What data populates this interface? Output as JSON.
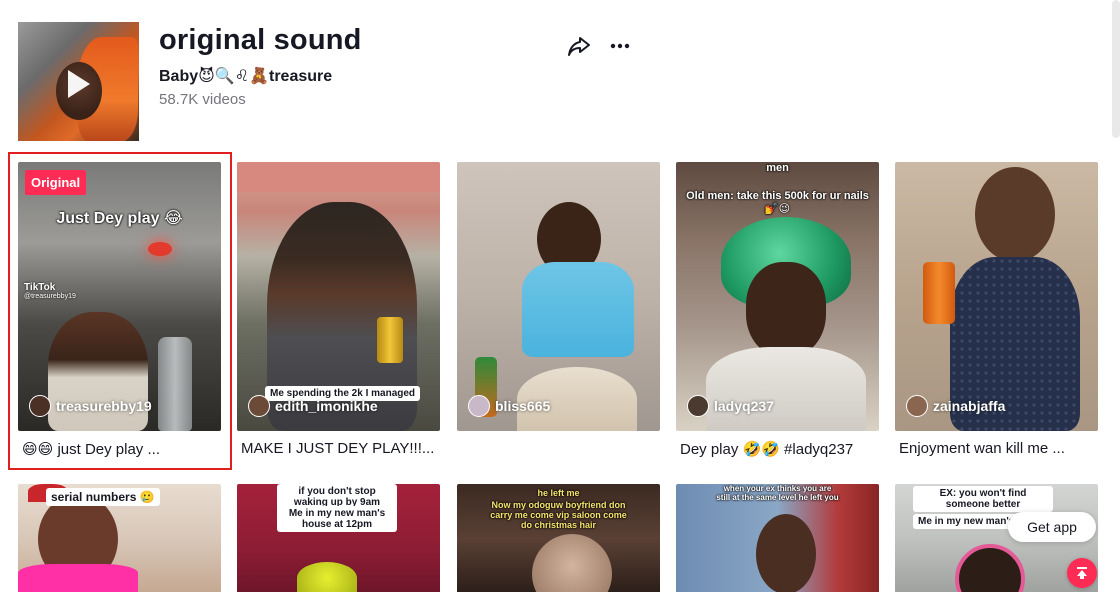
{
  "sound": {
    "title": "original sound",
    "author": "Baby😈🔍♌🧸treasure",
    "video_count": "58.7K videos"
  },
  "icons": {
    "share": "share-arrow-icon",
    "more": "more-dots-icon",
    "back_to_top": "arrow-up-icon"
  },
  "colors": {
    "accent": "#fe2c55",
    "selected_outline": "#e0201f"
  },
  "videos": [
    {
      "badge": "Original",
      "overlay": "Just Dey play 😂",
      "watermark": "TikTok",
      "watermark_handle": "@treasurebby19",
      "username": "treasurebby19",
      "caption": "😄😄 just Dey play ..."
    },
    {
      "overlay": "Me spending the 2k I managed",
      "username": "edith_imonikhe",
      "caption": "MAKE I JUST DEY PLAY!!!..."
    },
    {
      "overlay": "",
      "username": "bliss665",
      "caption": ""
    },
    {
      "overlay": "Old men: take this 500k for ur nails 💅😉",
      "overlay_top": "men",
      "username": "ladyq237",
      "caption": "Dey play 🤣🤣 #ladyq237"
    },
    {
      "overlay": "",
      "username": "zainabjaffa",
      "caption": "Enjoyment wan kill me ..."
    },
    {
      "overlay": "serial numbers 🥲",
      "username": "",
      "caption": ""
    },
    {
      "overlay": "if you don't stop waking up by 9am",
      "overlay2": "Me in my new man's house at 12pm",
      "username": "",
      "caption": ""
    },
    {
      "overlay": "he left me",
      "overlay2": "Now my odoguw boyfriend don carry me come vip saloon come do christmas hair",
      "username": "",
      "caption": ""
    },
    {
      "overlay": "when your ex thinks you are still at the same level he left you",
      "username": "",
      "caption": ""
    },
    {
      "overlay": "EX: you won't find someone better",
      "overlay2": "Me in my new man's",
      "username": "",
      "caption": ""
    }
  ],
  "floating": {
    "get_app": "Get app"
  }
}
